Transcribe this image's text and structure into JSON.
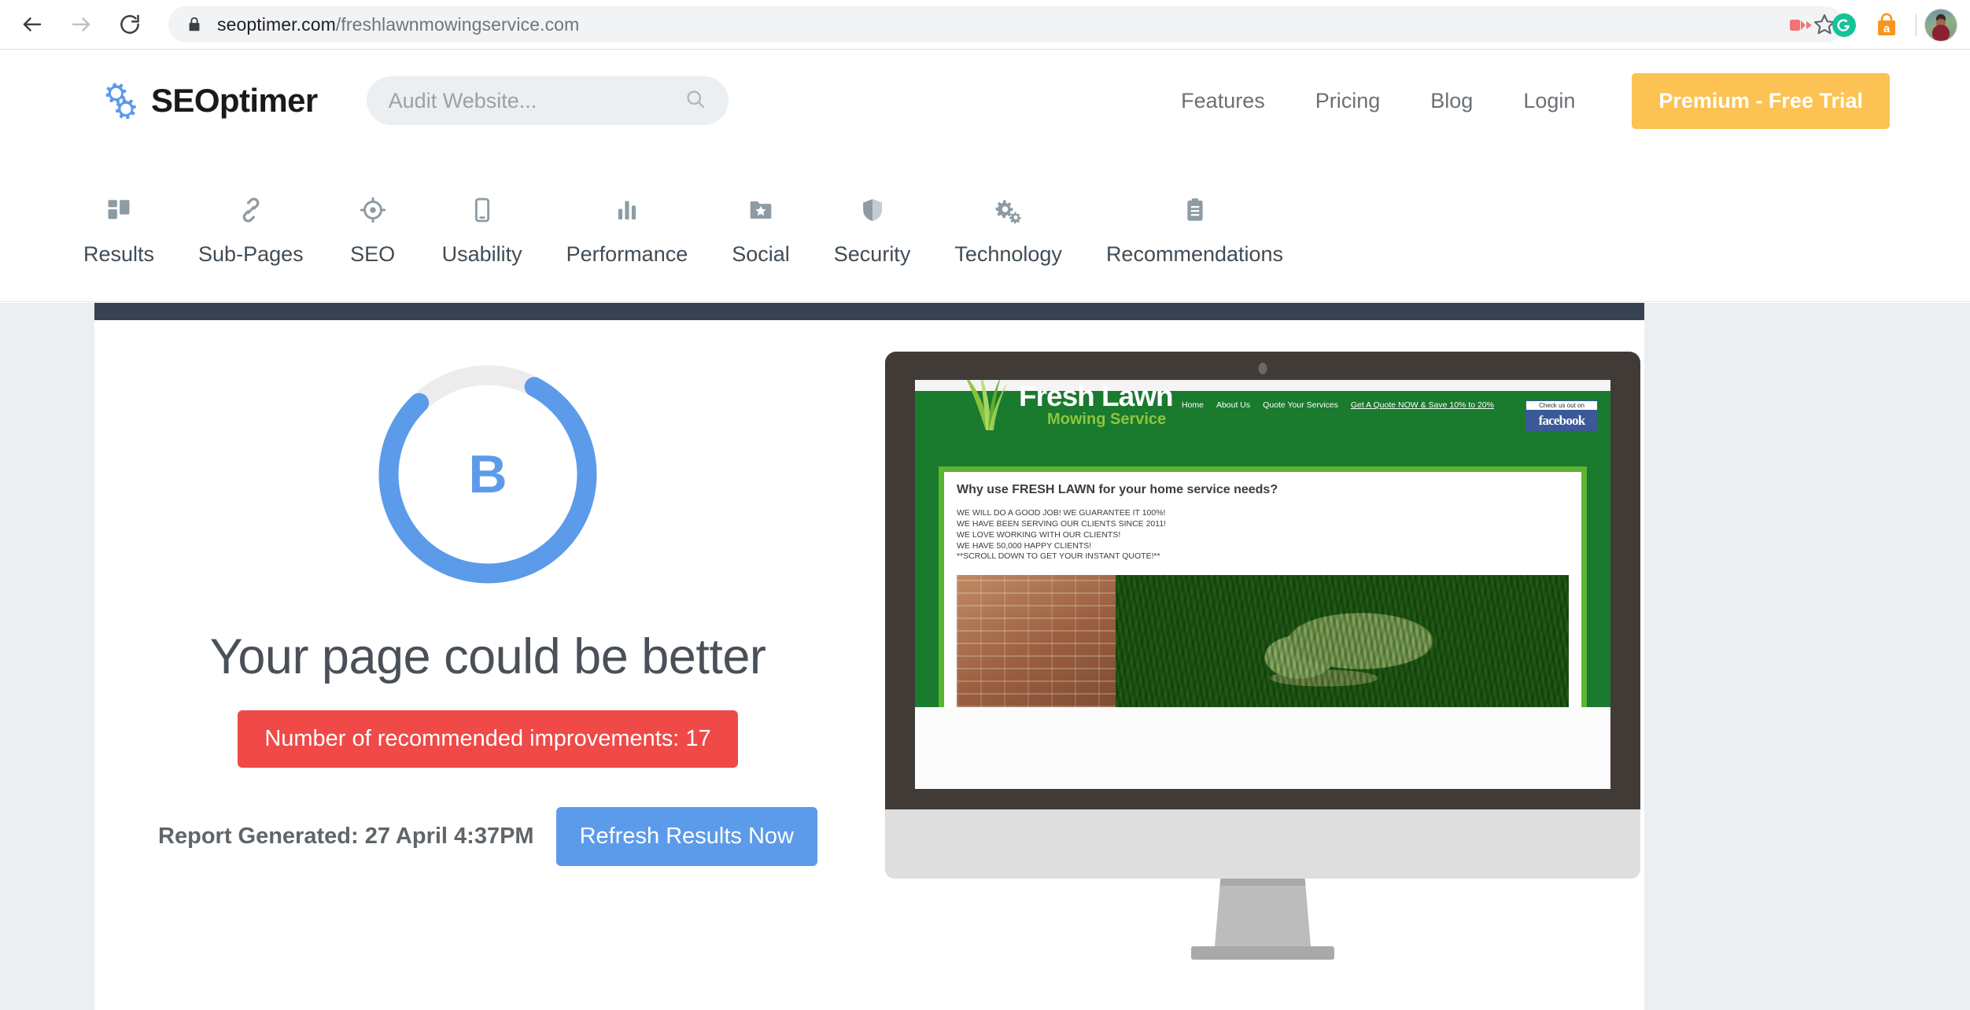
{
  "browser": {
    "url_prefix": "seoptimer.com",
    "url_suffix": "/freshlawnmowingservice.com",
    "back_title": "Back",
    "forward_title": "Forward",
    "reload_title": "Reload",
    "lock_title": "View site information",
    "bookmark_title": "Bookmark this tab",
    "extensions": [
      {
        "name": "video-recorder-extension-icon",
        "color": "#f4736f"
      },
      {
        "name": "grammarly-extension-icon",
        "color": "#15c39a"
      },
      {
        "name": "shopping-assistant-extension-icon",
        "color": "#f79520"
      }
    ],
    "profile_title": "Profile"
  },
  "header": {
    "logo_text": "SEOptimer",
    "search": {
      "placeholder": "Audit Website...",
      "value": "",
      "icon": "search-icon"
    },
    "nav": [
      {
        "label": "Features"
      },
      {
        "label": "Pricing"
      },
      {
        "label": "Blog"
      },
      {
        "label": "Login"
      }
    ],
    "cta": {
      "label": "Premium - Free Trial",
      "color": "#fcc254"
    }
  },
  "tabs": [
    {
      "label": "Results",
      "icon": "dashboard-grid-icon"
    },
    {
      "label": "Sub-Pages",
      "icon": "chain-link-icon"
    },
    {
      "label": "SEO",
      "icon": "target-crosshair-icon"
    },
    {
      "label": "Usability",
      "icon": "mobile-phone-icon"
    },
    {
      "label": "Performance",
      "icon": "bar-chart-icon"
    },
    {
      "label": "Social",
      "icon": "folder-star-icon"
    },
    {
      "label": "Security",
      "icon": "shield-icon"
    },
    {
      "label": "Technology",
      "icon": "gears-icon"
    },
    {
      "label": "Recommendations",
      "icon": "clipboard-icon"
    }
  ],
  "report": {
    "grade": "B",
    "ring_percent": 80,
    "ring_color": "#5b9bea",
    "ring_track_color": "#ececec",
    "headline": "Your page could be better",
    "improvements_badge": "Number of recommended improvements: 17",
    "improvements_count": "17",
    "badge_color": "#ef4a48",
    "generated_label": "Report Generated: 27 April 4:37PM",
    "refresh_label": "Refresh Results Now",
    "refresh_color": "#5b9bea"
  },
  "preview": {
    "device": "desktop-monitor",
    "site": {
      "brand_title": "Fresh Lawn",
      "brand_sub": "Mowing Service",
      "nav": [
        {
          "label": "Home",
          "underline": false
        },
        {
          "label": "About Us",
          "underline": false
        },
        {
          "label": "Quote Your Services",
          "underline": false
        },
        {
          "label": "Get A Quote NOW & Save 10% to 20%",
          "underline": true
        }
      ],
      "facebook_caption": "Check us out on",
      "facebook_label": "facebook",
      "heading": "Why use FRESH LAWN for your home service needs?",
      "body_lines": [
        "WE WILL DO A GOOD JOB! WE GUARANTEE IT 100%!",
        "WE HAVE BEEN SERVING OUR CLIENTS SINCE 2011!",
        "WE LOVE WORKING WITH OUR CLIENTS!",
        "WE HAVE 50,000 HAPPY CLIENTS!",
        "**SCROLL DOWN TO GET YOUR INSTANT QUOTE!**"
      ],
      "photo_alt": "string-trimmer-in-grass-photo",
      "brand_green": "#1a7a2e",
      "accent_green": "#5bb530",
      "sub_green": "#8cc63f"
    }
  }
}
